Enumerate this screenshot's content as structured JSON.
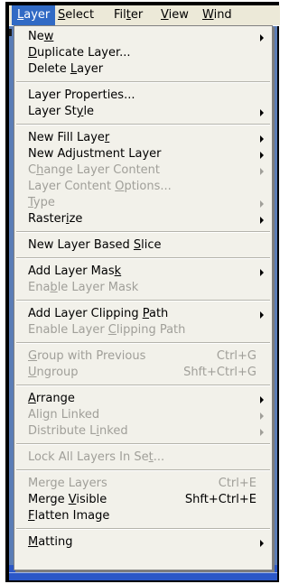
{
  "menubar": {
    "items": [
      {
        "label": "Layer",
        "ul": 0,
        "active": true
      },
      {
        "label": "Select",
        "ul": 0,
        "active": false
      },
      {
        "label": "Filter",
        "ul": 3,
        "active": false
      },
      {
        "label": "View",
        "ul": 0,
        "active": false
      },
      {
        "label": "Wind",
        "ul": 0,
        "active": false
      }
    ]
  },
  "menu": {
    "items": [
      {
        "label": "New",
        "ul": 2,
        "shortcut": "",
        "submenu": true,
        "disabled": false
      },
      {
        "label": "Duplicate Layer...",
        "ul": 0,
        "shortcut": "",
        "submenu": false,
        "disabled": false
      },
      {
        "label": "Delete Layer",
        "ul": 7,
        "shortcut": "",
        "submenu": false,
        "disabled": false
      },
      {
        "sep": true
      },
      {
        "label": "Layer Properties...",
        "ul": -1,
        "shortcut": "",
        "submenu": false,
        "disabled": false
      },
      {
        "label": "Layer Style",
        "ul": 8,
        "shortcut": "",
        "submenu": true,
        "disabled": false
      },
      {
        "sep": true
      },
      {
        "label": "New Fill Layer",
        "ul": 13,
        "shortcut": "",
        "submenu": true,
        "disabled": false
      },
      {
        "label": "New Adjustment Layer",
        "ul": -1,
        "shortcut": "",
        "submenu": true,
        "disabled": false
      },
      {
        "label": "Change Layer Content",
        "ul": 1,
        "shortcut": "",
        "submenu": true,
        "disabled": true
      },
      {
        "label": "Layer Content Options...",
        "ul": 14,
        "shortcut": "",
        "submenu": false,
        "disabled": true
      },
      {
        "label": "Type",
        "ul": 0,
        "shortcut": "",
        "submenu": true,
        "disabled": true
      },
      {
        "label": "Rasterize",
        "ul": 6,
        "shortcut": "",
        "submenu": true,
        "disabled": false
      },
      {
        "sep": true
      },
      {
        "label": "New Layer Based Slice",
        "ul": 16,
        "shortcut": "",
        "submenu": false,
        "disabled": false
      },
      {
        "sep": true
      },
      {
        "label": "Add Layer Mask",
        "ul": 13,
        "shortcut": "",
        "submenu": true,
        "disabled": false
      },
      {
        "label": "Enable Layer Mask",
        "ul": 3,
        "shortcut": "",
        "submenu": false,
        "disabled": true
      },
      {
        "sep": true
      },
      {
        "label": "Add Layer Clipping Path",
        "ul": 19,
        "shortcut": "",
        "submenu": true,
        "disabled": false
      },
      {
        "label": "Enable Layer Clipping Path",
        "ul": 13,
        "shortcut": "",
        "submenu": false,
        "disabled": true
      },
      {
        "sep": true
      },
      {
        "label": "Group with Previous",
        "ul": 0,
        "shortcut": "Ctrl+G",
        "submenu": false,
        "disabled": true
      },
      {
        "label": "Ungroup",
        "ul": 0,
        "shortcut": "Shft+Ctrl+G",
        "submenu": false,
        "disabled": true
      },
      {
        "sep": true
      },
      {
        "label": "Arrange",
        "ul": 0,
        "shortcut": "",
        "submenu": true,
        "disabled": false
      },
      {
        "label": "Align Linked",
        "ul": 3,
        "shortcut": "",
        "submenu": true,
        "disabled": true
      },
      {
        "label": "Distribute Linked",
        "ul": 12,
        "shortcut": "",
        "submenu": true,
        "disabled": true
      },
      {
        "sep": true
      },
      {
        "label": "Lock All Layers In Set...",
        "ul": 21,
        "shortcut": "",
        "submenu": false,
        "disabled": true
      },
      {
        "sep": true
      },
      {
        "label": "Merge Layers",
        "ul": -1,
        "shortcut": "Ctrl+E",
        "submenu": false,
        "disabled": true
      },
      {
        "label": "Merge Visible",
        "ul": 6,
        "shortcut": "Shft+Ctrl+E",
        "submenu": false,
        "disabled": false
      },
      {
        "label": "Flatten Image",
        "ul": 0,
        "shortcut": "",
        "submenu": false,
        "disabled": false
      },
      {
        "sep": true
      },
      {
        "label": "Matting",
        "ul": 0,
        "shortcut": "",
        "submenu": true,
        "disabled": false
      }
    ]
  }
}
